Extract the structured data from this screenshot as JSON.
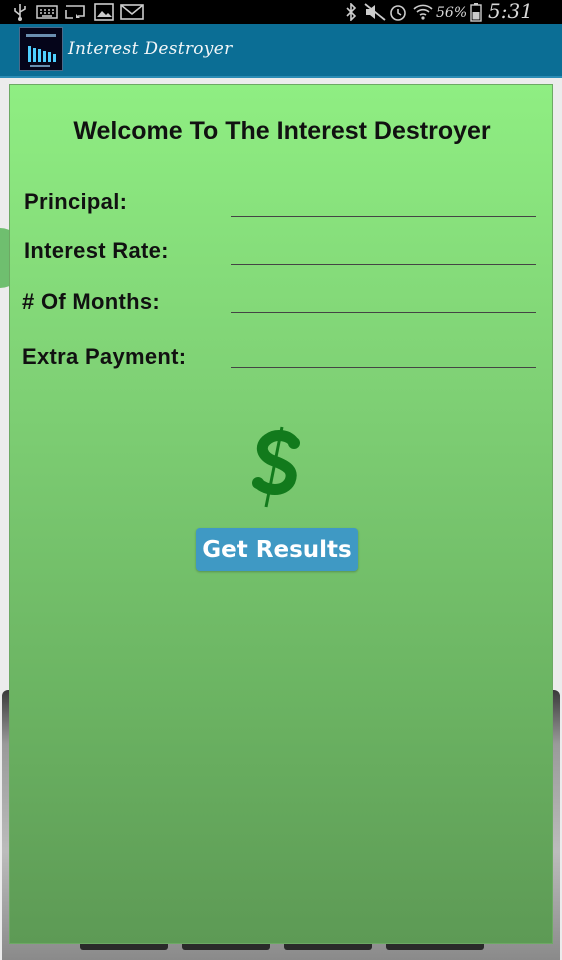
{
  "status_bar": {
    "battery_percent": "56%",
    "time": "5:31 PM",
    "icons": [
      "usb-icon",
      "keyboard-icon",
      "cast-icon",
      "image-icon",
      "gmail-icon",
      "bluetooth-icon",
      "mute-icon",
      "alarm-icon",
      "wifi-icon",
      "battery-icon"
    ]
  },
  "action_bar": {
    "title": "Interest Destroyer",
    "app_icon": "interest-destroyer-app-icon"
  },
  "dialog": {
    "heading": "Welcome To The Interest Destroyer",
    "fields": [
      {
        "label": "Principal:",
        "value": "",
        "placeholder": ""
      },
      {
        "label": "Interest Rate:",
        "value": "",
        "placeholder": ""
      },
      {
        "label": "# Of Months:",
        "value": "",
        "placeholder": ""
      },
      {
        "label": "Extra Payment:",
        "value": "",
        "placeholder": ""
      }
    ],
    "dollar_icon": "dollar-sign-icon",
    "button_label": "Get Results"
  },
  "colors": {
    "action_bar": "#0b6e95",
    "dialog_top": "#8fee82",
    "dialog_bottom": "#5d9a55",
    "button": "#3f99c4",
    "dollar": "#1a7a1a"
  }
}
